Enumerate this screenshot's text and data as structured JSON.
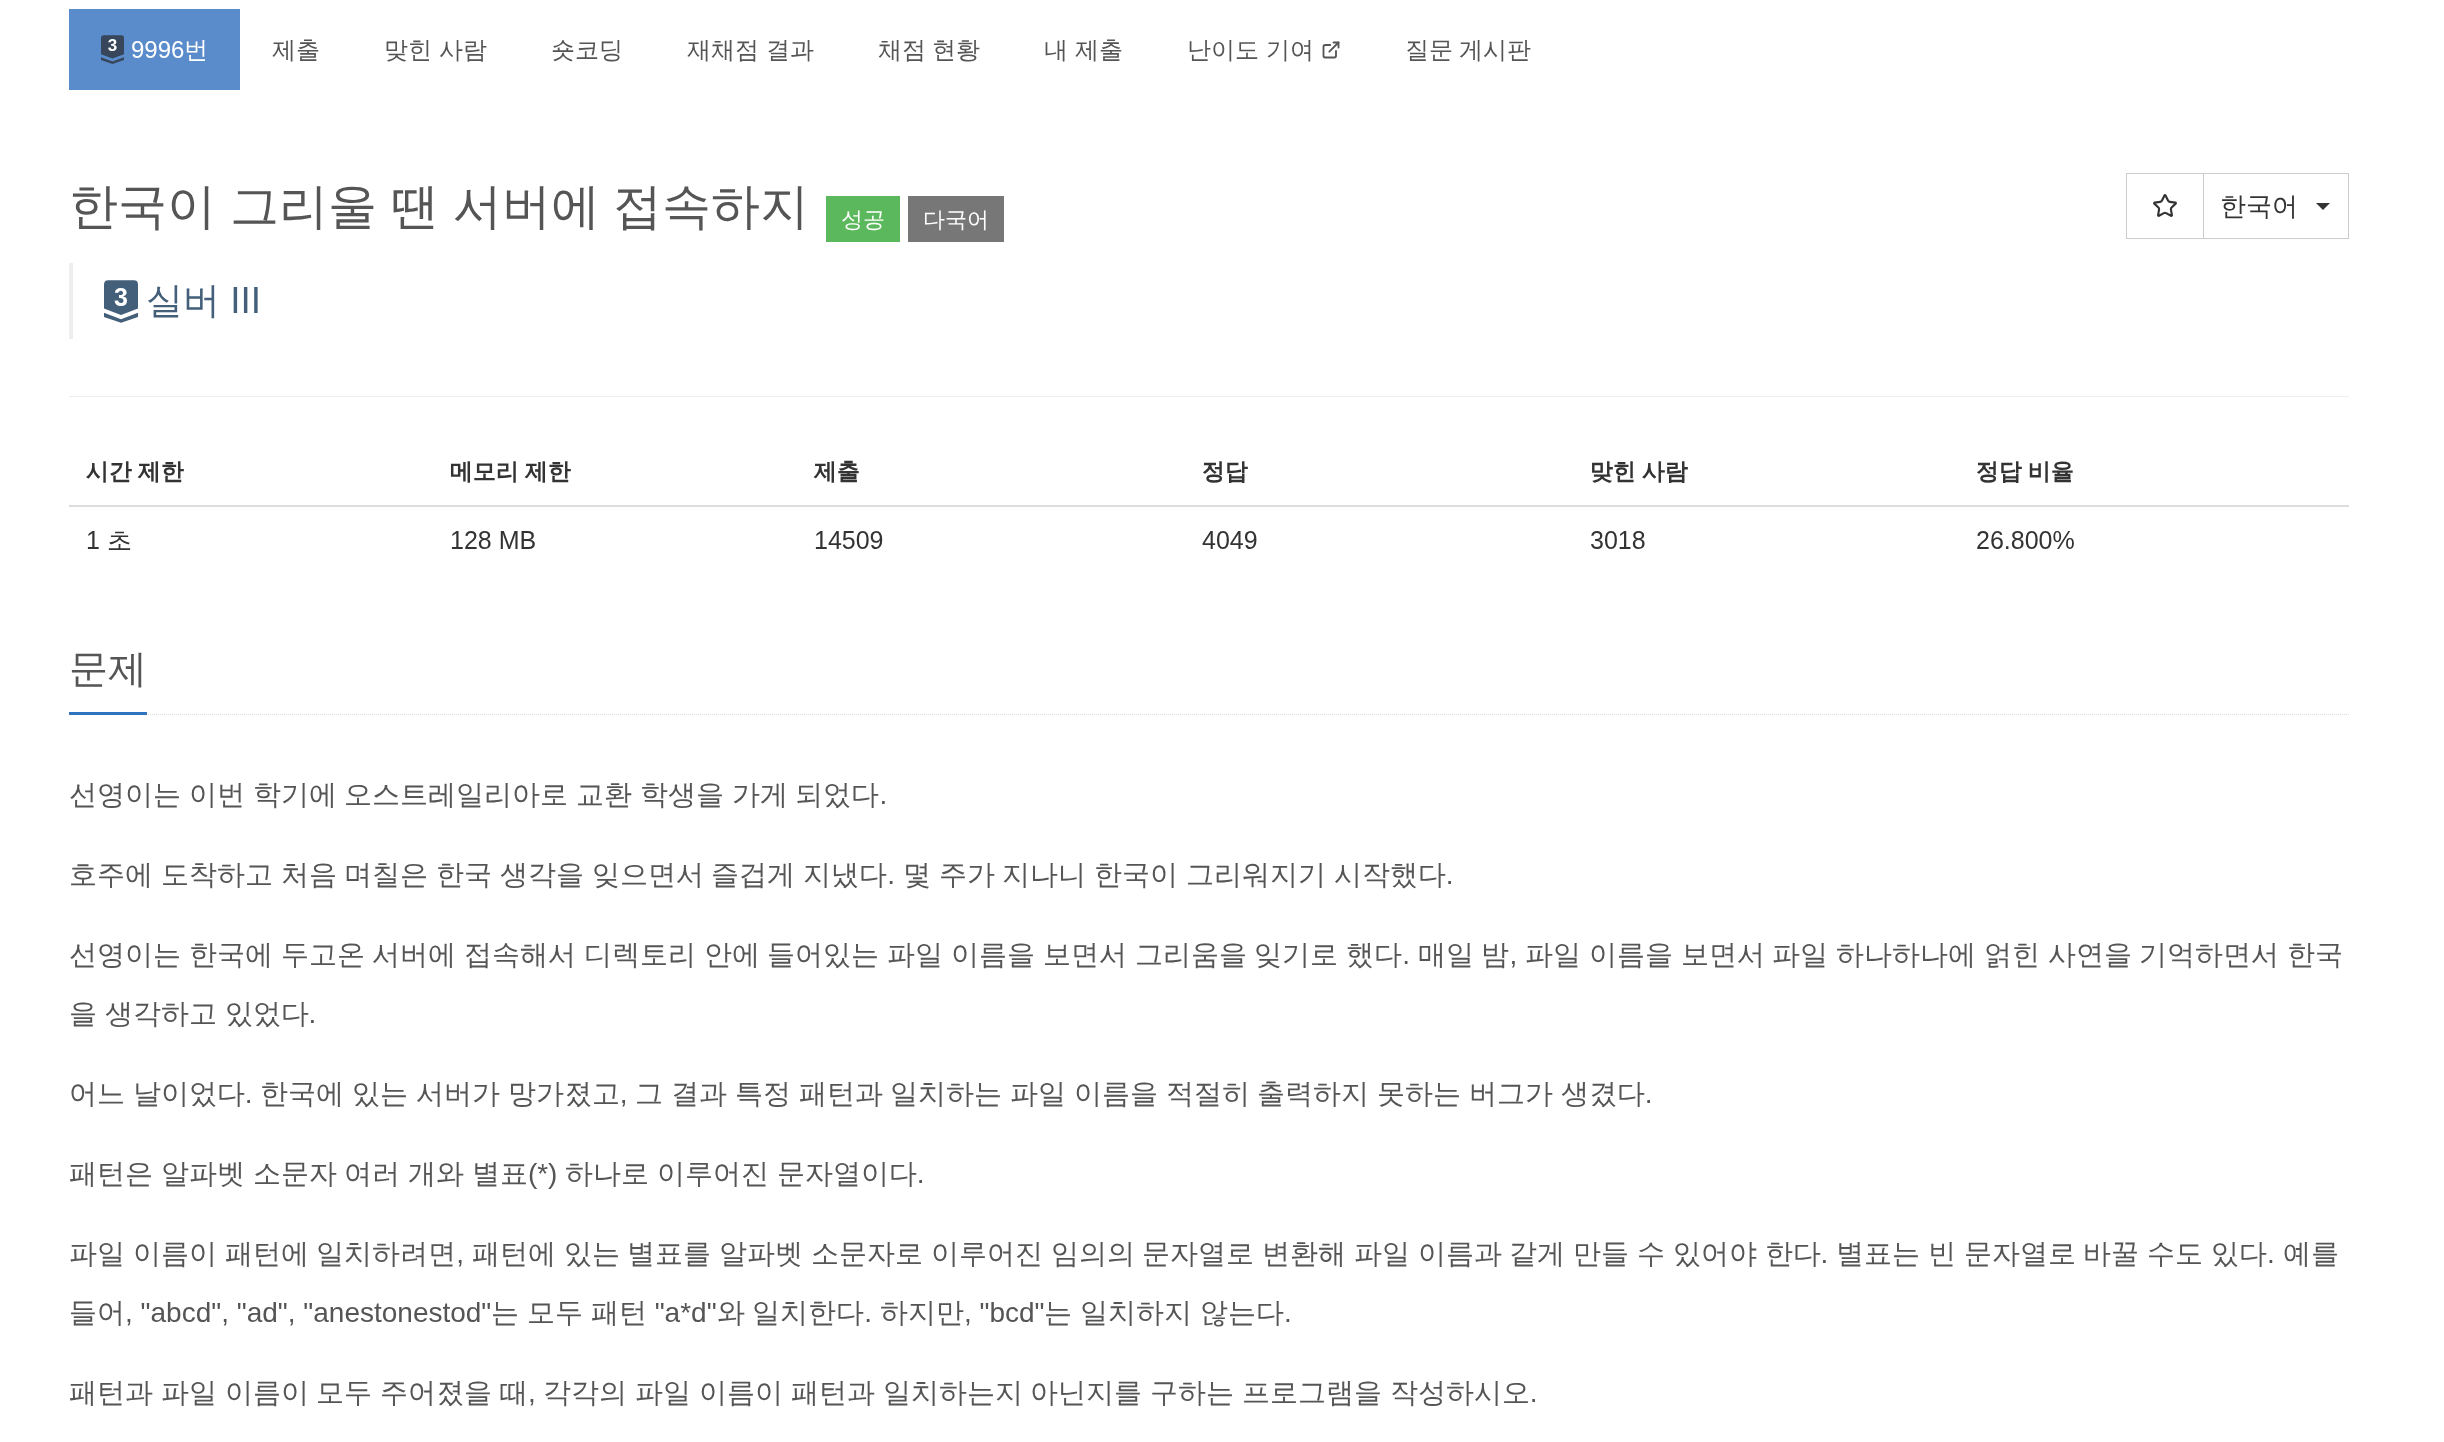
{
  "nav": {
    "tabs": [
      {
        "kind": "problem",
        "tier_number": "3",
        "label": "9996번",
        "selected": true
      },
      {
        "kind": "link",
        "label": "제출",
        "selected": false
      },
      {
        "kind": "link",
        "label": "맞힌 사람",
        "selected": false
      },
      {
        "kind": "link",
        "label": "숏코딩",
        "selected": false
      },
      {
        "kind": "link",
        "label": "재채점 결과",
        "selected": false
      },
      {
        "kind": "link",
        "label": "채점 현황",
        "selected": false
      },
      {
        "kind": "link",
        "label": "내 제출",
        "selected": false
      },
      {
        "kind": "external",
        "label": "난이도 기여",
        "selected": false
      },
      {
        "kind": "link",
        "label": "질문 게시판",
        "selected": false
      }
    ]
  },
  "problem": {
    "title": "한국이 그리울 땐 서버에 접속하지",
    "labels": [
      {
        "text": "성공",
        "color": "#5cb85c"
      },
      {
        "text": "다국어",
        "color": "#777777"
      }
    ],
    "tier": {
      "number": "3",
      "name": "실버 III"
    },
    "favorite": {
      "starred": false
    },
    "language": {
      "value": "한국어"
    }
  },
  "stats": {
    "columns": [
      "시간 제한",
      "메모리 제한",
      "제출",
      "정답",
      "맞힌 사람",
      "정답 비율"
    ],
    "rows": [
      [
        "1 초",
        "128 MB",
        "14509",
        "4049",
        "3018",
        "26.800%"
      ]
    ]
  },
  "section": {
    "title": "문제",
    "paragraphs": [
      "선영이는 이번 학기에 오스트레일리아로 교환 학생을 가게 되었다.",
      "호주에 도착하고 처음 며칠은 한국 생각을 잊으면서 즐겁게 지냈다. 몇 주가 지나니 한국이 그리워지기 시작했다.",
      "선영이는 한국에 두고온 서버에 접속해서 디렉토리 안에 들어있는 파일 이름을 보면서 그리움을 잊기로 했다. 매일 밤, 파일 이름을 보면서 파일 하나하나에 얽힌 사연을 기억하면서 한국을 생각하고 있었다.",
      "어느 날이었다. 한국에 있는 서버가 망가졌고, 그 결과 특정 패턴과 일치하는 파일 이름을 적절히 출력하지 못하는 버그가 생겼다.",
      "패턴은 알파벳 소문자 여러 개와 별표(*) 하나로 이루어진 문자열이다.",
      "파일 이름이 패턴에 일치하려면, 패턴에 있는 별표를 알파벳 소문자로 이루어진 임의의 문자열로 변환해 파일 이름과 같게 만들 수 있어야 한다. 별표는 빈 문자열로 바꿀 수도 있다. 예를 들어, \"abcd\", \"ad\", \"anestonestod\"는 모두 패턴 \"a*d\"와 일치한다. 하지만, \"bcd\"는 일치하지 않는다.",
      "패턴과 파일 이름이 모두 주어졌을 때, 각각의 파일 이름이 패턴과 일치하는지 아닌지를 구하는 프로그램을 작성하시오."
    ]
  }
}
